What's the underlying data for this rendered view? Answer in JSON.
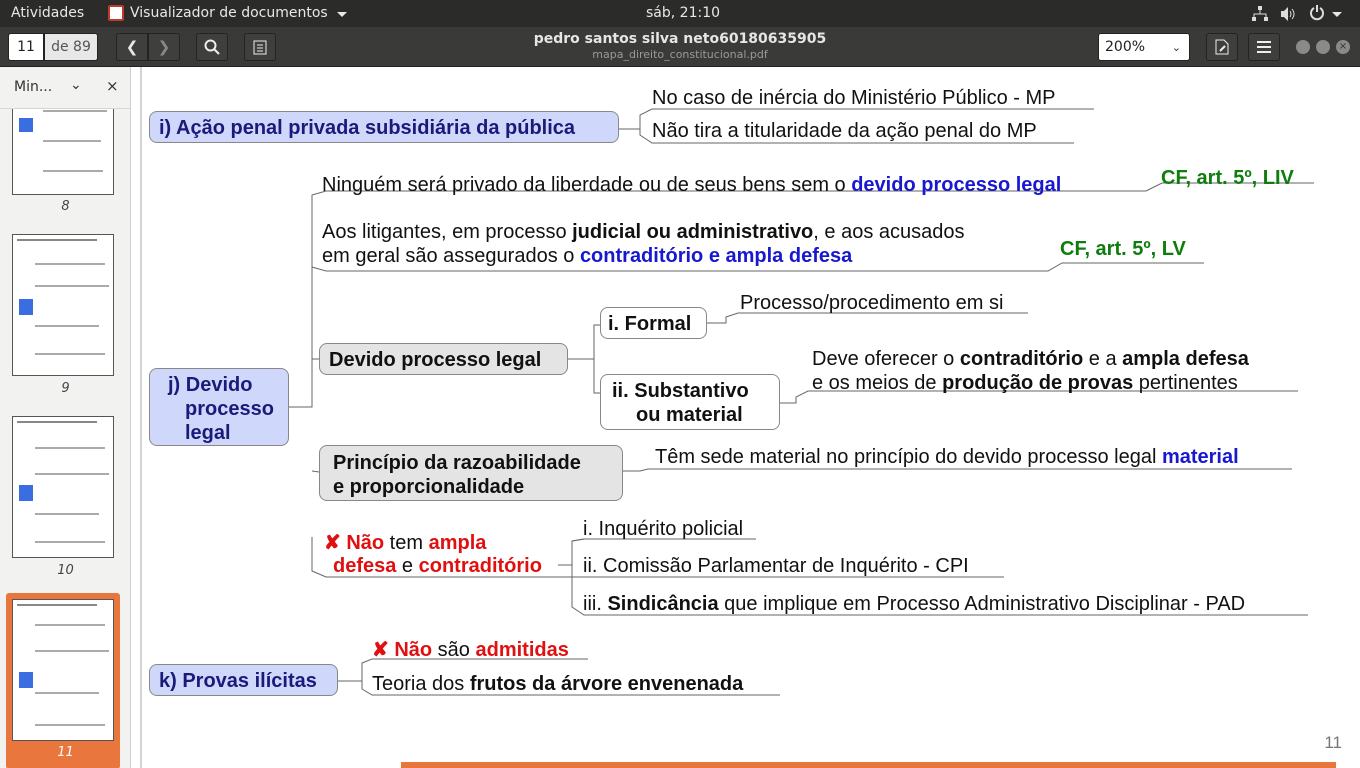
{
  "topbar": {
    "activities": "Atividades",
    "app_menu": "Visualizador de documentos",
    "clock": "sáb, 21:10"
  },
  "header": {
    "page_current": "11",
    "page_total": "de 89",
    "title": "pedro santos silva neto60180635905",
    "subtitle": "mapa_direito_constitucional.pdf",
    "zoom": "200%"
  },
  "sidebar": {
    "dropdown_label": "Min...",
    "close": "×",
    "thumbs": [
      "8",
      "9",
      "10",
      "11"
    ],
    "selected": "11"
  },
  "content": {
    "i_title": "i) Ação penal privada subsidiária da pública",
    "i_1": "No caso de inércia do Ministério Público - MP",
    "i_2": "Não tira a titularidade da ação penal do MP",
    "j_title_1": "j) Devido",
    "j_title_2": "processo",
    "j_title_3": "legal",
    "j1_a": "Ninguém será privado da liberdade ou de seus bens sem o ",
    "j1_b": "devido processo legal",
    "j1_ref": "CF, art. 5º, LIV",
    "j2_a": "Aos litigantes, em processo ",
    "j2_b": "judicial ou administrativo",
    "j2_c": ", e aos acusados",
    "j2_d": "em geral são assegurados o ",
    "j2_e": "contraditório e ampla defesa",
    "j2_ref": "CF, art. 5º, LV",
    "dpl": "Devido processo legal",
    "formal": "i. Formal",
    "formal_desc": "Processo/procedimento em si",
    "subst_1": "ii. Substantivo",
    "subst_2": "ou material",
    "subst_a": "Deve oferecer o ",
    "subst_b": "contraditório",
    "subst_c": " e a ",
    "subst_d": "ampla defesa",
    "subst_e": "e os meios de ",
    "subst_f": "produção de provas",
    "subst_g": " pertinentes",
    "razo_1": "Princípio da razoabilidade",
    "razo_2": "e proporcionalidade",
    "razo_a": "Têm sede material no princípio do devido processo legal ",
    "razo_b": "material",
    "nao_mark": "✘",
    "nao_1a": "Não",
    "nao_1b": " tem ",
    "nao_1c": "ampla",
    "nao_2a": "defesa",
    "nao_2b": " e ",
    "nao_2c": "contraditório",
    "nao_i1": "i. Inquérito policial",
    "nao_i2": "ii. Comissão Parlamentar de Inquérito - CPI",
    "nao_i3a": "iii. ",
    "nao_i3b": "Sindicância",
    "nao_i3c": " que implique em Processo Administrativo Disciplinar - PAD",
    "k_title": "k) Provas ilícitas",
    "k_1a": "Não",
    "k_1b": " são ",
    "k_1c": "admitidas",
    "k_2a": "Teoria dos ",
    "k_2b": "frutos da árvore envenenada",
    "page_number": "11"
  },
  "colors": {
    "accent_orange": "#e9763c",
    "blue_text": "#1818d0",
    "red_text": "#e01010",
    "green_text": "#0e7d0e",
    "node_blue": "#cfd8fb",
    "node_grey": "#e4e4e4"
  },
  "icons": [
    "document-viewer-icon",
    "chevron-left-icon",
    "chevron-right-icon",
    "search-icon",
    "clipboard-icon",
    "annotate-icon",
    "hamburger-menu-icon",
    "network-icon",
    "volume-icon",
    "power-icon"
  ]
}
